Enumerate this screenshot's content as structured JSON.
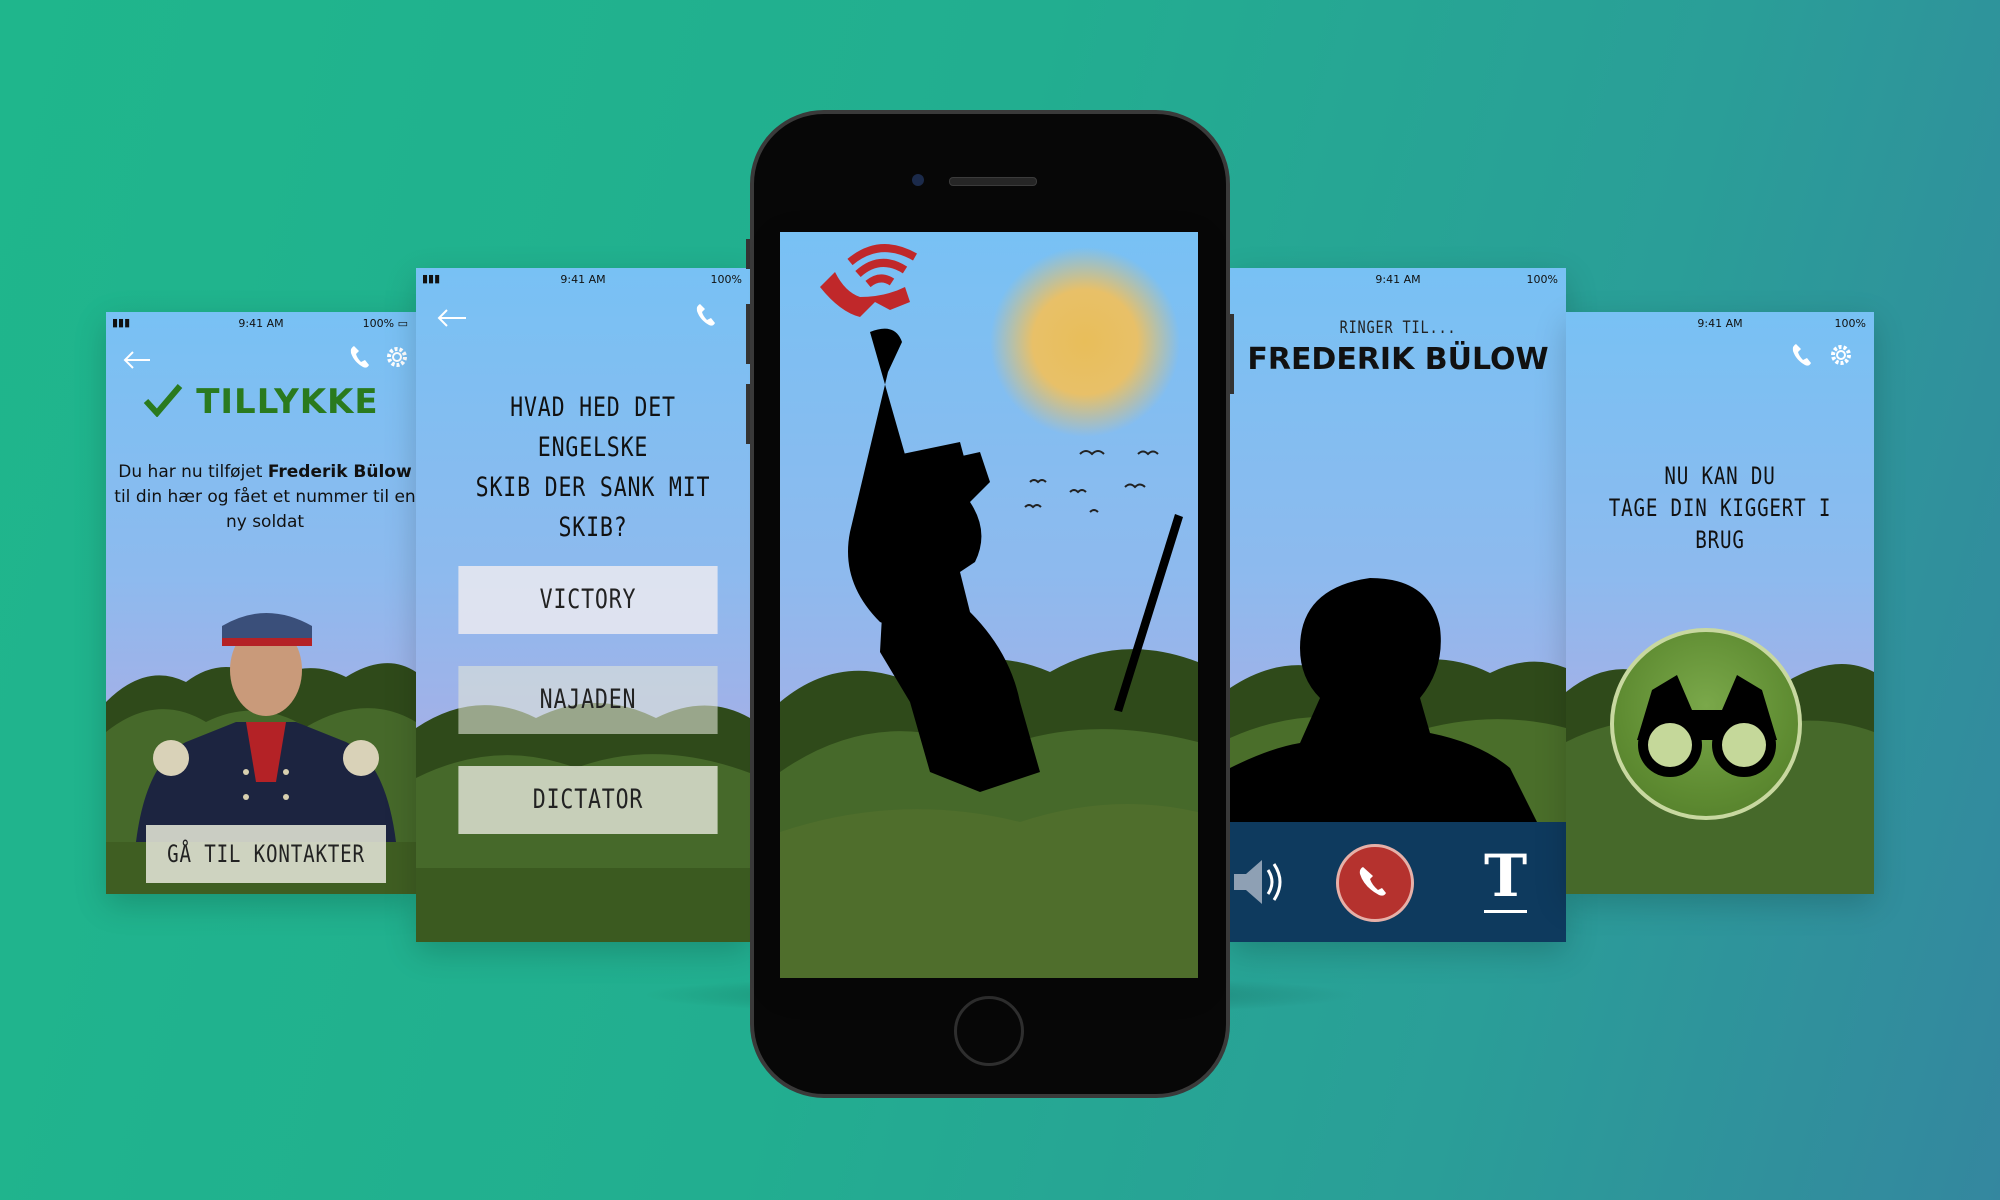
{
  "status": {
    "time": "9:41 AM",
    "battery": "100%"
  },
  "screen1": {
    "title": "TILLYKKE",
    "msg_pre": "Du har nu tilføjet ",
    "msg_name": "Frederik Bülow",
    "msg_post": "til din hær og fået et nummer til en ny soldat",
    "button": "GÅ TIL KONTAKTER"
  },
  "screen2": {
    "question_line1": "HVAD HED DET ENGELSKE",
    "question_line2": "SKIB DER SANK MIT SKIB?",
    "options": [
      "VICTORY",
      "NAJADEN",
      "DICTATOR"
    ]
  },
  "screen4": {
    "subtitle": "RINGER TIL...",
    "name": "FREDERIK BÜLOW",
    "end_call_icon": "phone-icon",
    "text_icon_label": "T"
  },
  "screen5": {
    "line1": "NU KAN DU",
    "line2": "TAGE DIN KIGGERT I",
    "line3": "BRUG",
    "icon": "binoculars-icon"
  },
  "icons": [
    "back-arrow-icon",
    "phone-icon",
    "gear-icon",
    "checkmark-icon",
    "speaker-icon"
  ],
  "colors": {
    "accent_green": "#2a7a1e",
    "call_bar": "#0e3a5e",
    "hangup_red": "#b5322e",
    "signal_red": "#c0282a"
  }
}
